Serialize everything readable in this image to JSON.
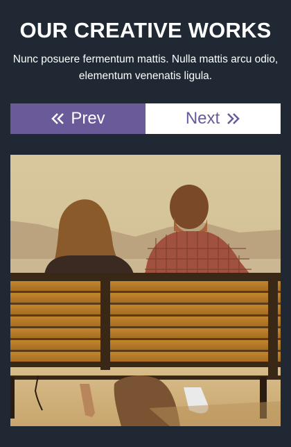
{
  "header": {
    "title": "OUR CREATIVE WORKS",
    "subtitle": "Nunc posuere fermentum mattis. Nulla mattis arcu odio, elementum venenatis ligula."
  },
  "pager": {
    "prev_label": "Prev",
    "next_label": "Next",
    "prev_icon": "double-chevron-left-icon",
    "next_icon": "double-chevron-right-icon"
  },
  "gallery": {
    "image_subject": "couple-on-bench-photo"
  },
  "colors": {
    "background": "#1f2833",
    "accent": "#6a5a9a",
    "text": "#ffffff"
  }
}
